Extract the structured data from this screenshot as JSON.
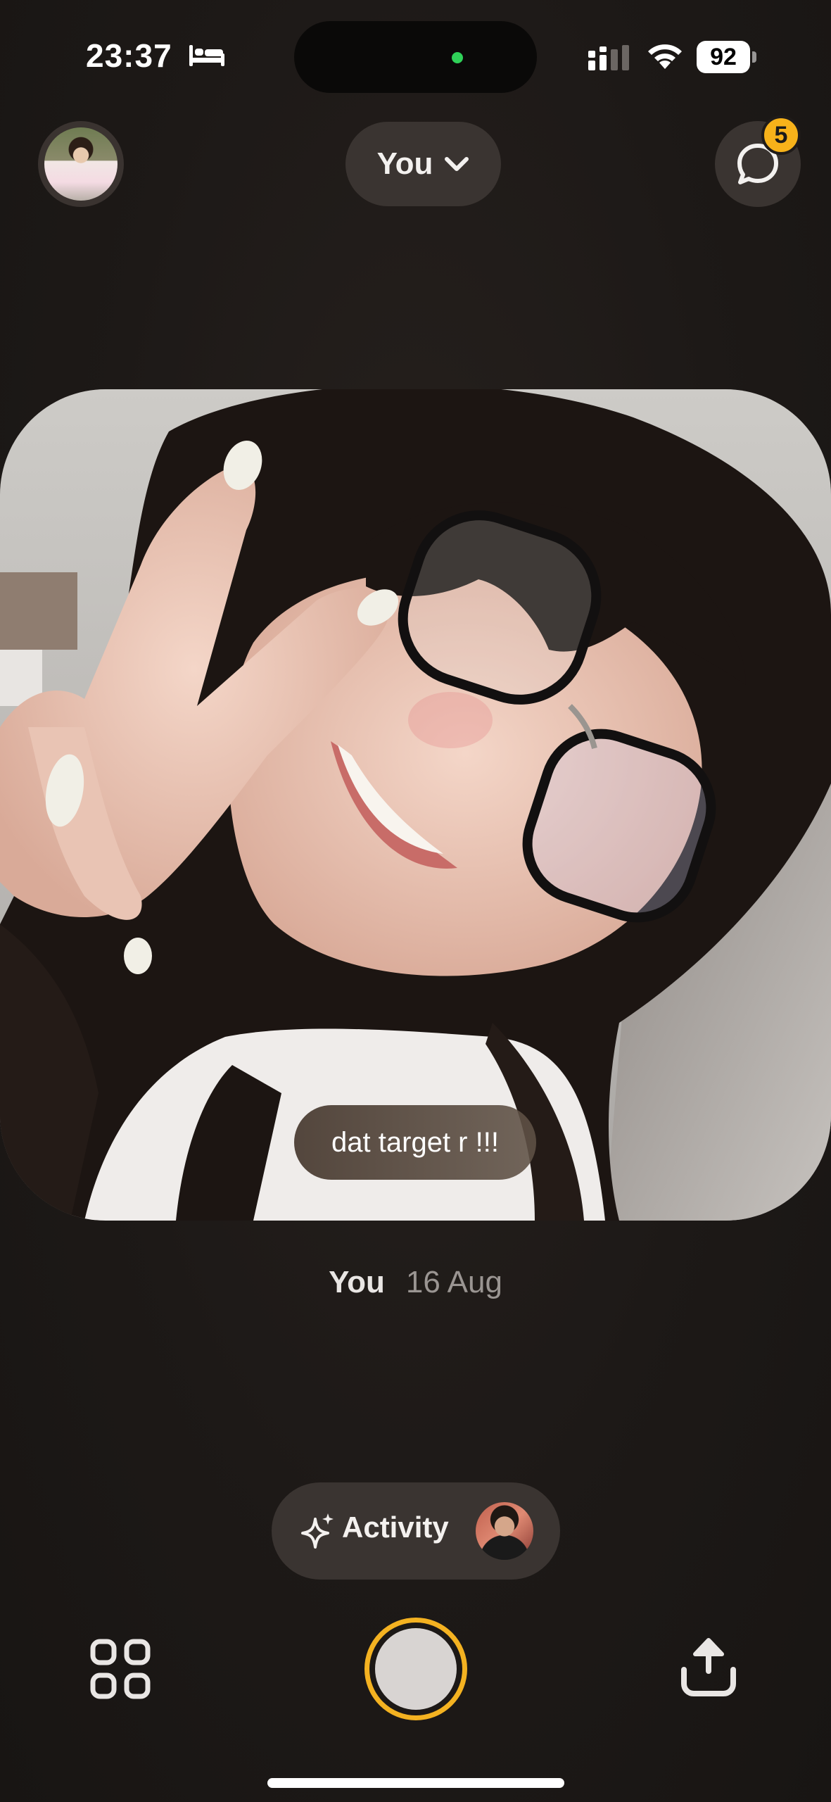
{
  "status_bar": {
    "time": "23:37",
    "battery": "92",
    "icons": [
      "bed-icon",
      "cellular-signal-icon",
      "wifi-icon",
      "battery-icon"
    ]
  },
  "header": {
    "profile_icon": "profile-avatar",
    "selector_label": "You",
    "selector_icon": "chevron-down-icon",
    "messages_icon": "chat-bubble-icon",
    "messages_badge": "5"
  },
  "post": {
    "caption": "dat target r !!!",
    "author": "You",
    "date": "16 Aug"
  },
  "activity": {
    "label": "Activity",
    "icon": "sparkle-icon"
  },
  "bottom_bar": {
    "icons": [
      "grid-icon",
      "capture-button",
      "share-icon"
    ]
  },
  "colors": {
    "accent": "#f4b221",
    "background": "#1f1b19",
    "pill": "#3a3431"
  }
}
